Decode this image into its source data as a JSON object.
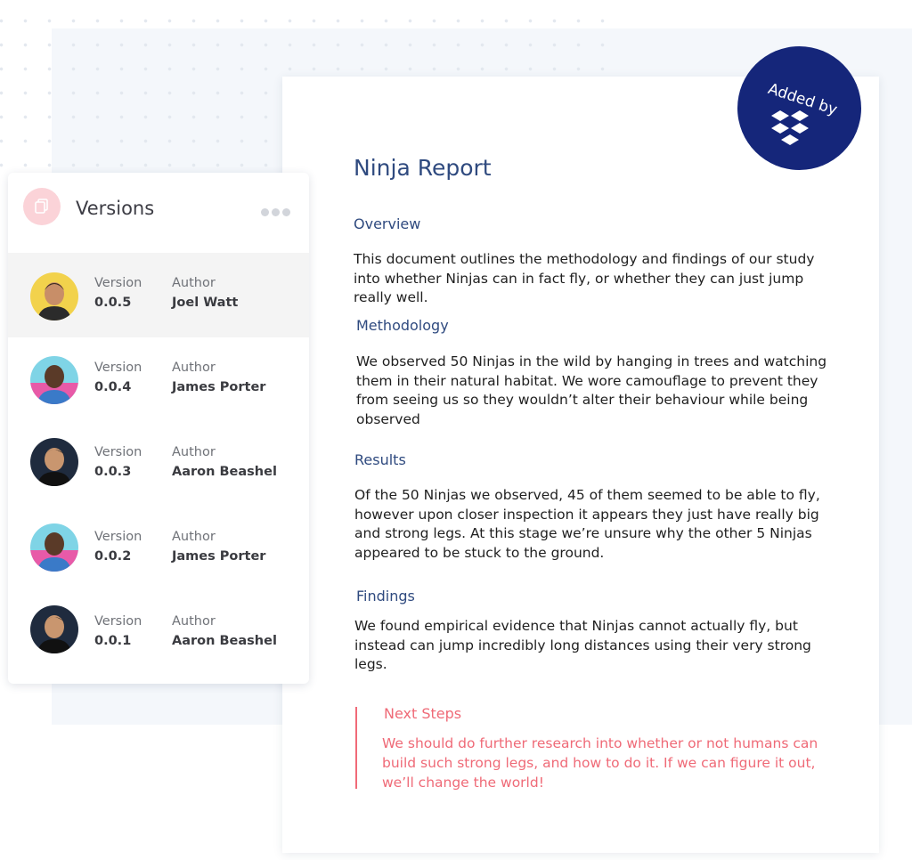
{
  "document": {
    "title": "Ninja Report",
    "sections": [
      {
        "heading": "Overview",
        "body": "This document outlines the methodology and findings of our study into whether Ninjas can in fact fly, or whether they can just jump really well."
      },
      {
        "heading": "Methodology",
        "body": "We observed 50 Ninjas in the wild by hanging in trees and watching them in their natural habitat. We wore camouflage to prevent they from seeing us so they wouldn’t alter their behaviour while being observed"
      },
      {
        "heading": "Results",
        "body": "Of the 50 Ninjas we observed, 45 of them seemed to be able to fly, however upon closer inspection it appears they just have really big and strong legs. At this stage we’re unsure why the other 5 Ninjas appeared to be stuck to the ground."
      },
      {
        "heading": "Findings",
        "body": "We found empirical evidence that Ninjas cannot actually fly, but instead can jump incredibly long distances using their very strong legs."
      }
    ],
    "callout": {
      "heading": "Next Steps",
      "body": "We should do further research into whether or not humans can build such strong legs, and how to do it. If we can figure it out, we’ll change the world!"
    }
  },
  "badge": {
    "text": "Added by",
    "icon": "dropbox-icon"
  },
  "versions_panel": {
    "title": "Versions",
    "icon": "copy-icon",
    "menu_icon": "more-dots-icon",
    "version_label": "Version",
    "author_label": "Author",
    "items": [
      {
        "version": "0.0.5",
        "author": "Joel Watt",
        "active": true
      },
      {
        "version": "0.0.4",
        "author": "James Porter"
      },
      {
        "version": "0.0.3",
        "author": "Aaron Beashel"
      },
      {
        "version": "0.0.2",
        "author": "James Porter"
      },
      {
        "version": "0.0.1",
        "author": "Aaron Beashel"
      }
    ]
  },
  "colors": {
    "heading": "#2f4a7f",
    "callout": "#ef6a77",
    "badge": "#15267a"
  }
}
